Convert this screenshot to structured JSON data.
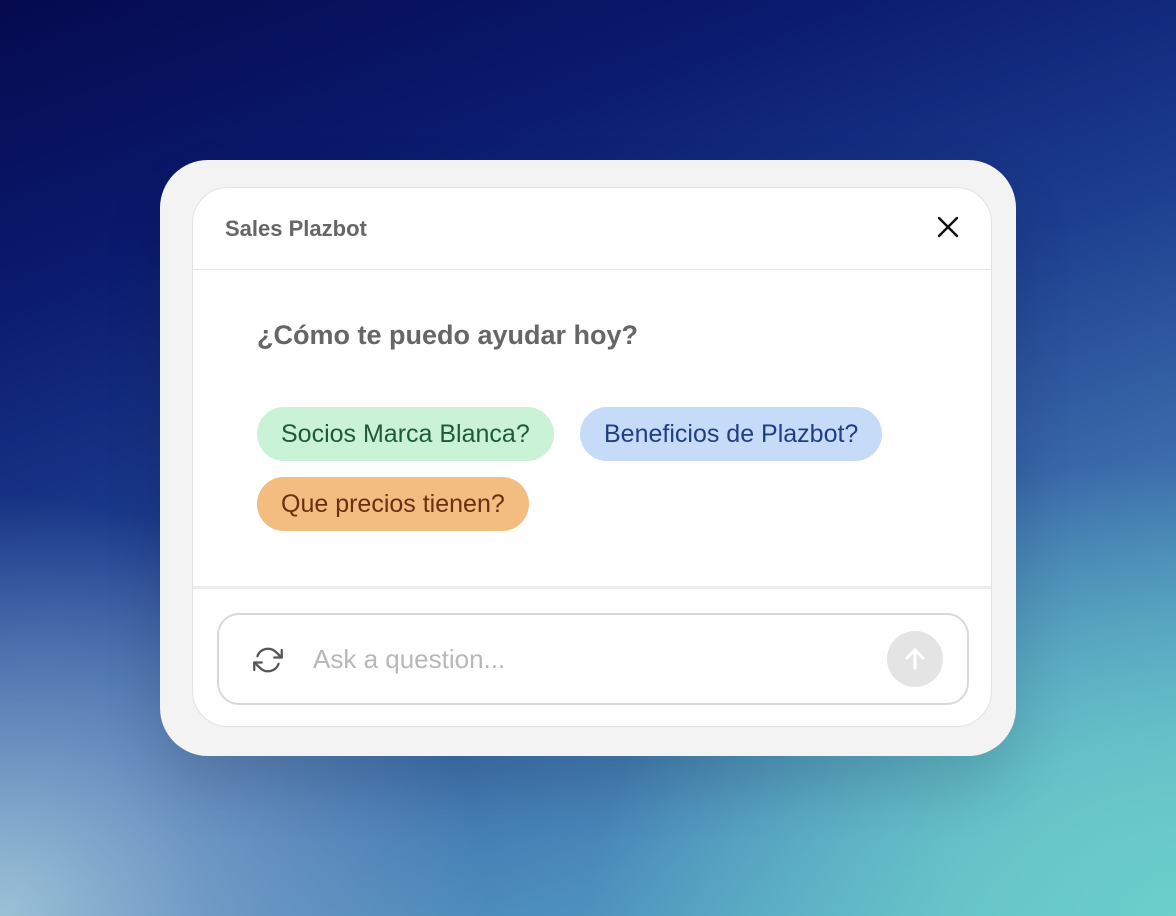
{
  "widget": {
    "title": "Sales Plazbot",
    "close_icon": "close-icon"
  },
  "conversation": {
    "greeting": "¿Cómo te puedo ayudar hoy?",
    "suggestions": [
      {
        "label": "Socios Marca Blanca?",
        "color": "#c9f2d7"
      },
      {
        "label": "Beneficios de Plazbot?",
        "color": "#c6dbf8"
      },
      {
        "label": "Que precios tienen?",
        "color": "#f3bc80"
      }
    ]
  },
  "composer": {
    "refresh_icon": "refresh-icon",
    "placeholder": "Ask a question...",
    "value": "",
    "send_icon": "arrow-up-icon"
  }
}
